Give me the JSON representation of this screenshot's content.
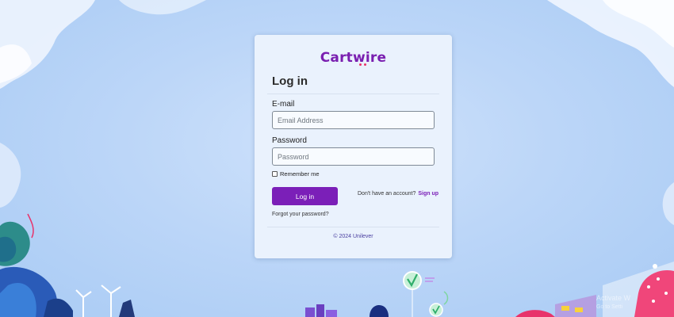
{
  "brand": {
    "logo_text": "Cartwire"
  },
  "login": {
    "title": "Log in",
    "email_label": "E-mail",
    "email_placeholder": "Email Address",
    "email_value": "",
    "password_label": "Password",
    "password_placeholder": "Password",
    "password_value": "",
    "remember_label": "Remember me",
    "remember_checked": false,
    "submit_label": "Log in",
    "signup_prompt": "Don't have an account?",
    "signup_link": "Sign up",
    "forgot_link": "Forgot your password?"
  },
  "footer": {
    "copyright": "© 2024 Unilever"
  },
  "watermark": {
    "line1": "Activate W",
    "line2": "Go to Setti"
  },
  "colors": {
    "accent": "#7b1fb8",
    "logo": "#7a1fb0",
    "logo_dots": "#e8336b",
    "background": "#bcd6f8",
    "card": "#eaf2fd"
  },
  "icons": {
    "decor_checkmark": "check-badge-icon"
  }
}
